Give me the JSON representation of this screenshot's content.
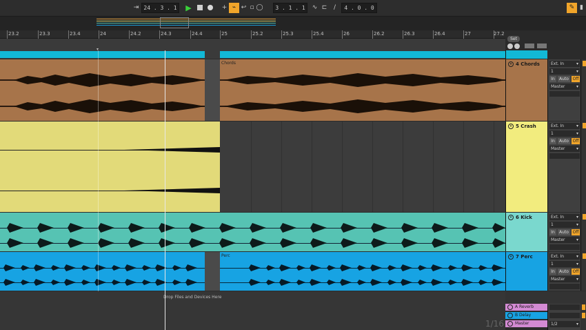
{
  "transport": {
    "arrangement_position": "24 . 3 . 1",
    "loop_start": "3 . 1 . 1",
    "loop_length": "4 . 0 . 0"
  },
  "ruler": {
    "labels": [
      "23.2",
      "23.3",
      "23.4",
      "24",
      "24.2",
      "24.3",
      "24.4",
      "25",
      "25.2",
      "25.3",
      "25.4",
      "26",
      "26.2",
      "26.3",
      "26.4",
      "27",
      "27.2"
    ]
  },
  "set_label": "Set",
  "drop_hint": "Drop Files and Devices Here",
  "zoom_label": "1/16",
  "colors": {
    "chords": "#a7744a",
    "crash": "#e2da79",
    "kick": "#56c3b3",
    "perc": "#17a3e3",
    "locator": "#12b8d6",
    "returns": "#d38ad3",
    "master": "#d38ad3"
  },
  "tracks": [
    {
      "name": "4 Chords",
      "clip_name": "Chords",
      "input": "Ext. In",
      "channel": "1",
      "monitor_in": "In",
      "monitor_auto": "Auto",
      "monitor_off": "Off",
      "output": "Master"
    },
    {
      "name": "5 Crash",
      "clip_name": "",
      "input": "Ext. In",
      "channel": "1",
      "monitor_in": "In",
      "monitor_auto": "Auto",
      "monitor_off": "Off",
      "output": "Master"
    },
    {
      "name": "6 Kick",
      "clip_name": "",
      "input": "Ext. In",
      "channel": "1",
      "monitor_in": "In",
      "monitor_auto": "Auto",
      "monitor_off": "Off",
      "output": "Master"
    },
    {
      "name": "7 Perc",
      "clip_name": "Perc",
      "input": "Ext. In",
      "channel": "1",
      "monitor_in": "In",
      "monitor_auto": "Auto",
      "monitor_off": "Off",
      "output": "Master"
    }
  ],
  "returns": [
    {
      "name": "A Reverb"
    },
    {
      "name": "B Delay"
    }
  ],
  "master": {
    "name": "Master",
    "output": "1/2"
  }
}
